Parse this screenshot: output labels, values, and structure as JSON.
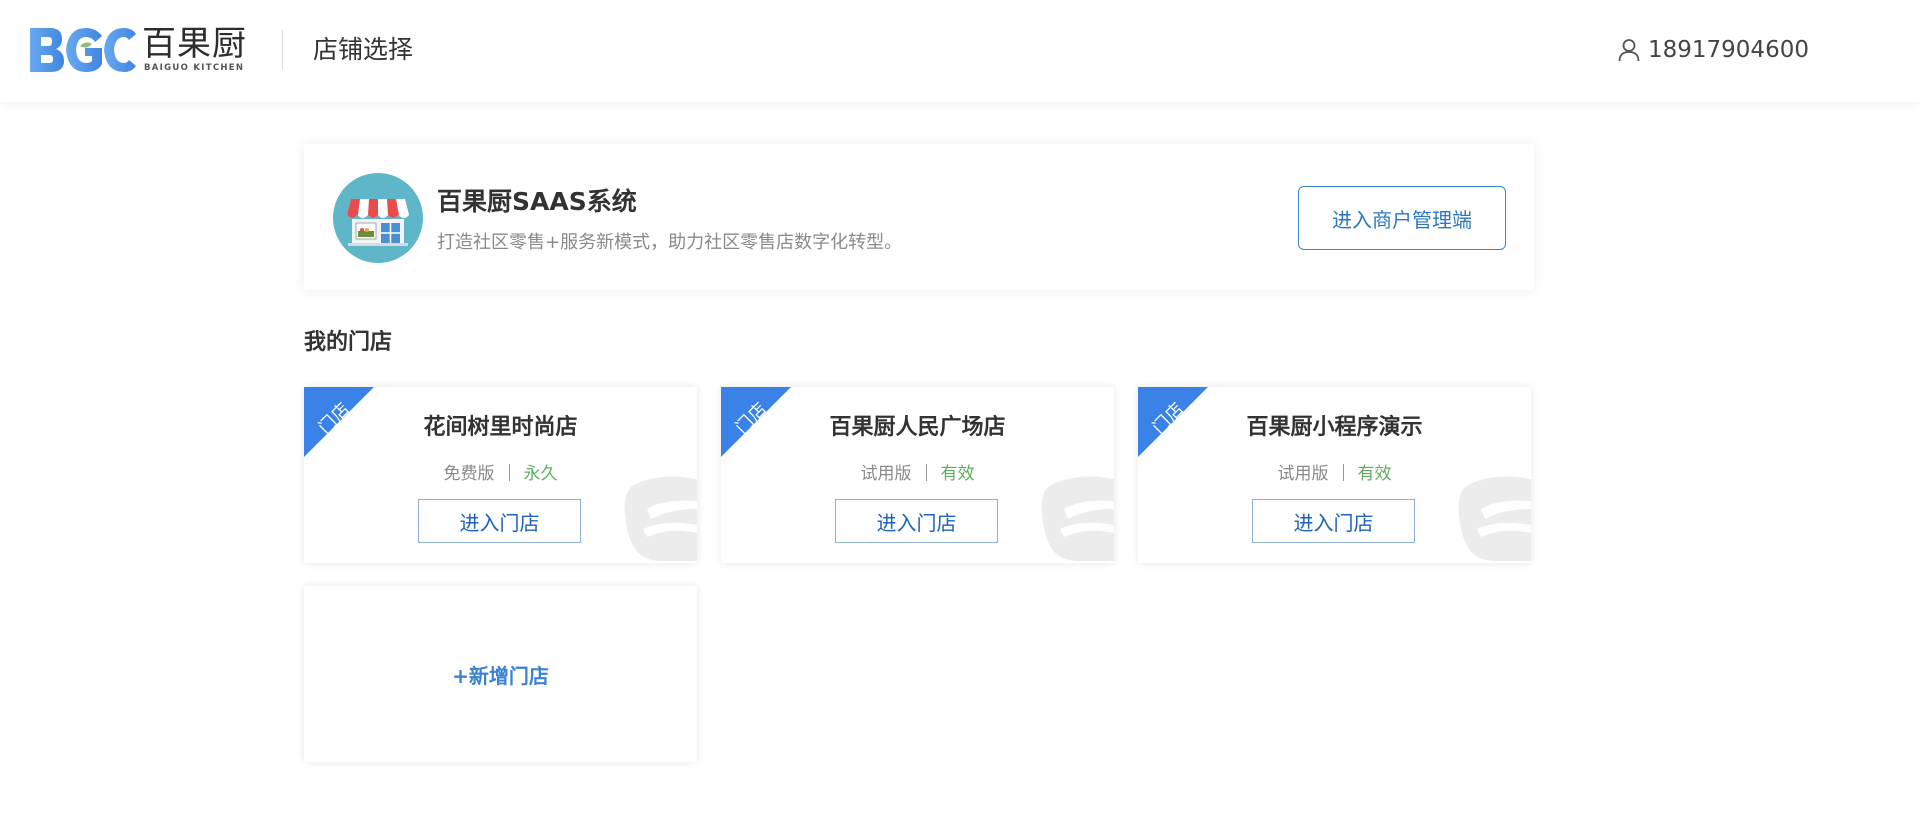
{
  "header": {
    "logo_cn": "百果厨",
    "logo_en": "BAIGUO KITCHEN",
    "title": "店铺选择",
    "user_phone": "18917904600"
  },
  "system": {
    "title": "百果厨SAAS系统",
    "description": "打造社区零售+服务新模式，助力社区零售店数字化转型。",
    "merchant_button": "进入商户管理端"
  },
  "stores_section": {
    "title": "我的门店",
    "ribbon_label": "门店",
    "stores": [
      {
        "name": "花间树里时尚店",
        "plan": "免费版",
        "status": "永久",
        "button": "进入门店"
      },
      {
        "name": "百果厨人民广场店",
        "plan": "试用版",
        "status": "有效",
        "button": "进入门店"
      },
      {
        "name": "百果厨小程序演示",
        "plan": "试用版",
        "status": "有效",
        "button": "进入门店"
      }
    ],
    "add_store": "+新增门店"
  },
  "colors": {
    "brand_blue": "#4a90e2",
    "button_blue": "#2b78c2",
    "valid_green": "#5fae5f"
  }
}
